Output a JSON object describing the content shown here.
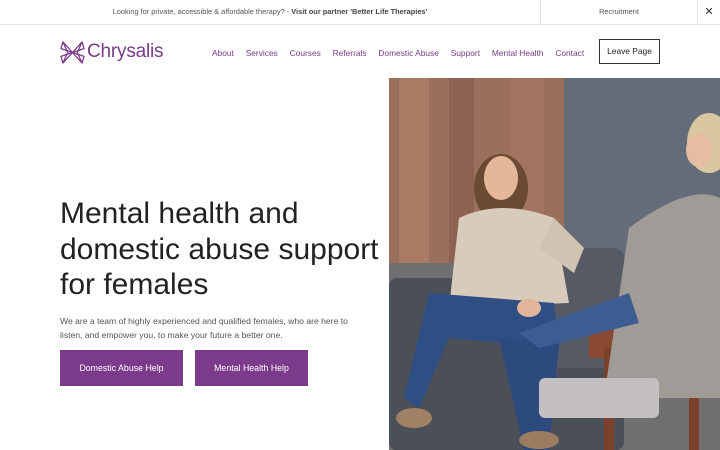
{
  "announcement": {
    "text": "Looking for private, accessible & affordable therapy? - ",
    "link": "Visit our partner 'Better Life Therapies'",
    "recruitment": "Recruitment",
    "close_symbol": "✕"
  },
  "brand": {
    "name": "Chrysalis",
    "icon": "butterfly-logo-icon",
    "color": "#7b3a8a"
  },
  "nav": {
    "items": [
      "About",
      "Services",
      "Courses",
      "Referrals",
      "Domestic Abuse",
      "Support",
      "Mental Health",
      "Contact"
    ],
    "leave_page": "Leave Page"
  },
  "hero": {
    "title": "Mental health and domestic abuse support for females",
    "subtitle": "We are a team of highly experienced and qualified females, who are here to listen, and empower you, to make your future a better one.",
    "buttons": {
      "domestic_abuse": "Domestic Abuse Help",
      "mental_health": "Mental Health Help"
    },
    "button_color": "#7b3a8a"
  }
}
